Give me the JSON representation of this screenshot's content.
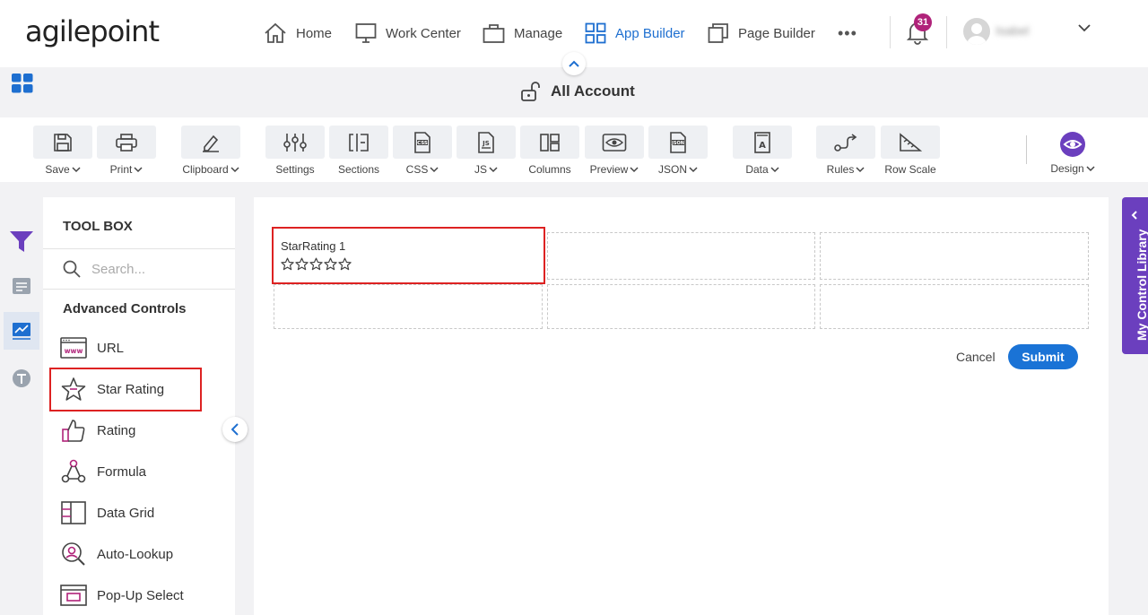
{
  "brand": {
    "logo": "agilepoint"
  },
  "nav": {
    "items": [
      {
        "label": "Home",
        "icon": "home-icon"
      },
      {
        "label": "Work Center",
        "icon": "monitor-icon"
      },
      {
        "label": "Manage",
        "icon": "briefcase-icon"
      },
      {
        "label": "App Builder",
        "icon": "grid-icon"
      },
      {
        "label": "Page Builder",
        "icon": "pages-icon"
      }
    ],
    "more_label": "•••",
    "notification_count": "31",
    "user_name": "Isabel"
  },
  "account": {
    "label": "All Account"
  },
  "toolbar": {
    "items": [
      {
        "label": "Save",
        "icon": "save-icon",
        "dropdown": true
      },
      {
        "label": "Print",
        "icon": "print-icon",
        "dropdown": true
      },
      {
        "label": "Clipboard",
        "icon": "clipboard-icon",
        "dropdown": true
      },
      {
        "label": "Settings",
        "icon": "settings-sliders-icon",
        "dropdown": false
      },
      {
        "label": "Sections",
        "icon": "sections-icon",
        "dropdown": false
      },
      {
        "label": "CSS",
        "icon": "css-file-icon",
        "dropdown": true
      },
      {
        "label": "JS",
        "icon": "js-file-icon",
        "dropdown": true
      },
      {
        "label": "Columns",
        "icon": "columns-icon",
        "dropdown": false
      },
      {
        "label": "Preview",
        "icon": "preview-eye-icon",
        "dropdown": true
      },
      {
        "label": "JSON",
        "icon": "json-file-icon",
        "dropdown": true
      },
      {
        "label": "Data",
        "icon": "data-icon",
        "dropdown": true
      },
      {
        "label": "Rules",
        "icon": "rules-icon",
        "dropdown": true
      },
      {
        "label": "Row Scale",
        "icon": "row-scale-icon",
        "dropdown": false
      }
    ],
    "design_label": "Design"
  },
  "toolbox": {
    "title": "TOOL BOX",
    "search_placeholder": "Search...",
    "section": "Advanced Controls",
    "items": [
      {
        "label": "URL",
        "icon": "www-icon"
      },
      {
        "label": "Star Rating",
        "icon": "star-icon"
      },
      {
        "label": "Rating",
        "icon": "thumbs-up-icon"
      },
      {
        "label": "Formula",
        "icon": "formula-icon"
      },
      {
        "label": "Data Grid",
        "icon": "data-grid-icon"
      },
      {
        "label": "Auto-Lookup",
        "icon": "auto-lookup-icon"
      },
      {
        "label": "Pop-Up Select",
        "icon": "popup-select-icon"
      }
    ]
  },
  "form": {
    "control_label": "StarRating 1",
    "star_count": 5,
    "cancel_label": "Cancel",
    "submit_label": "Submit"
  },
  "right_panel": {
    "label": "My Control Library"
  },
  "colors": {
    "accent": "#1a73d6",
    "purple": "#6b3fbe",
    "highlight": "#dd2222"
  }
}
